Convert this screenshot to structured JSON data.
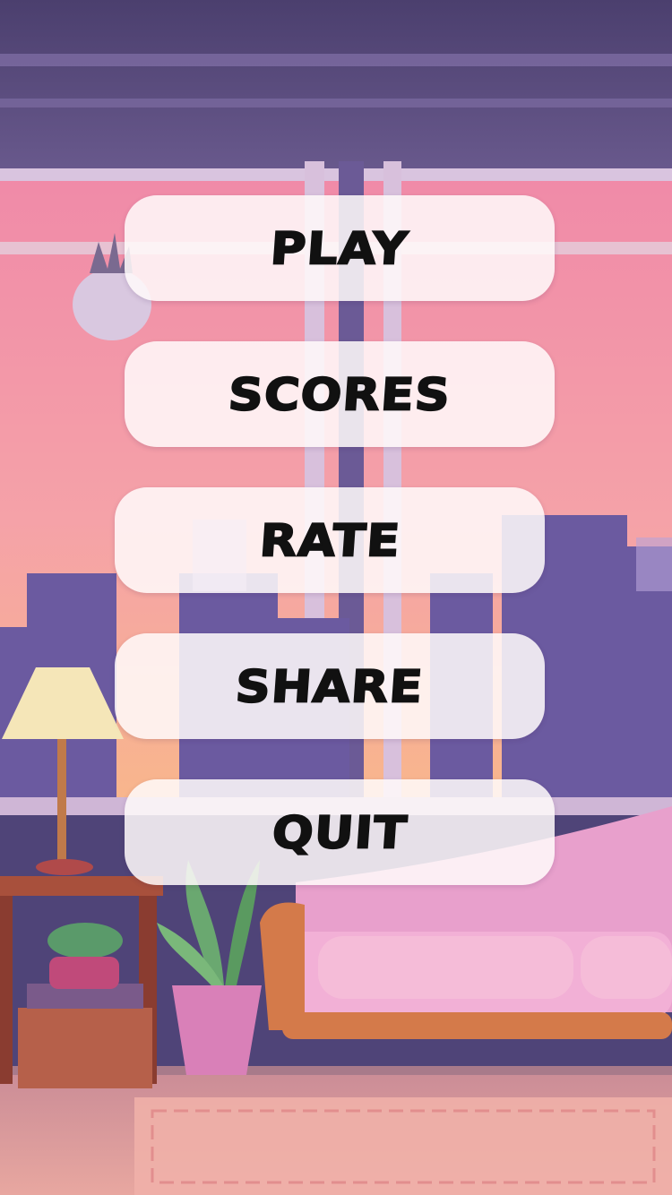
{
  "menu": {
    "play_label": "PLAY",
    "scores_label": "SCORES",
    "rate_label": "RATE",
    "share_label": "SHARE",
    "quit_label": "QUIT"
  },
  "colors": {
    "sky_top": "#f08aa8",
    "sky_bottom": "#f7b08a",
    "wall_purple": "#5a4a86",
    "sofa_pink": "#e79cc8",
    "button_bg": "#fff7f7",
    "label_color": "#111111"
  }
}
